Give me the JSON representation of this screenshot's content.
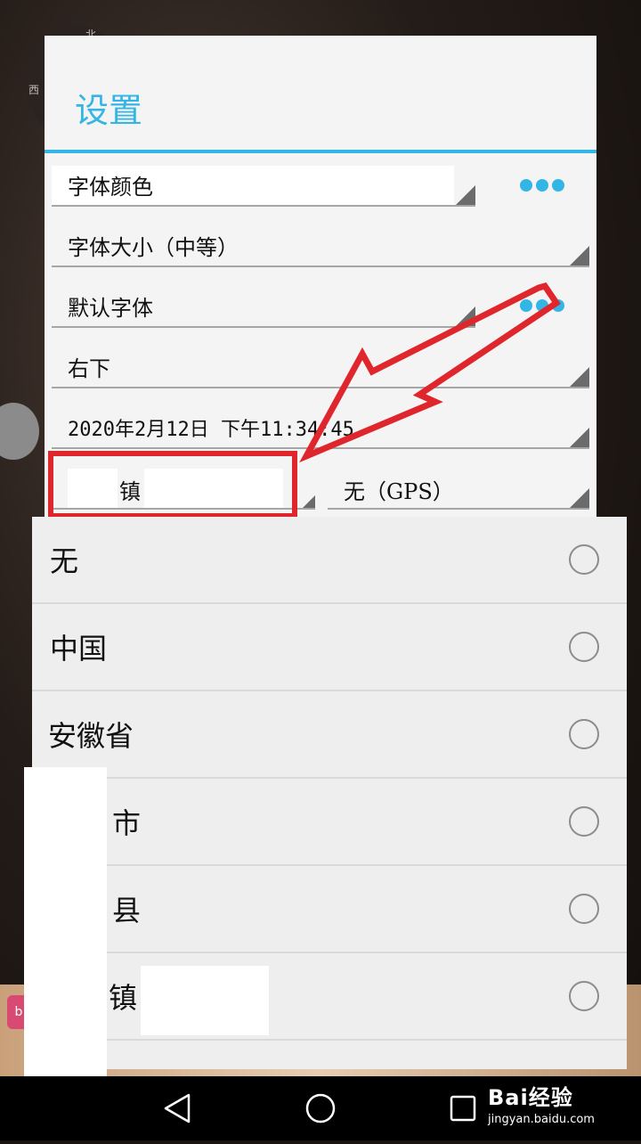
{
  "background": {
    "compass": {
      "north": "北",
      "west": "西"
    },
    "badge_text": "b"
  },
  "settings": {
    "title": "设置",
    "fields": {
      "font_color": "字体颜色",
      "font_size": "字体大小（中等）",
      "default_font": "默认字体",
      "position": "右下",
      "datetime": "2020年2月12日  下午11:34:45",
      "location": "镇",
      "location_source": "无（GPS）"
    },
    "more_icon": "ellipsis-icon"
  },
  "dropdown": {
    "options": [
      {
        "label": "无",
        "selected": false
      },
      {
        "label": "中国",
        "selected": false
      },
      {
        "label": "安徽省",
        "selected": false
      },
      {
        "label": "市",
        "selected": false
      },
      {
        "label": "县",
        "selected": false
      },
      {
        "label": "镇",
        "selected": false
      }
    ]
  },
  "annotation": {
    "color": "#e0262d"
  },
  "colors": {
    "accent": "#33b5e5",
    "annotation": "#e0262d"
  },
  "navbar": {
    "back": "back-icon",
    "home": "home-icon",
    "recent": "recent-apps-icon"
  },
  "watermark": {
    "brand": "Bai经验",
    "url": "jingyan.baidu.com"
  }
}
